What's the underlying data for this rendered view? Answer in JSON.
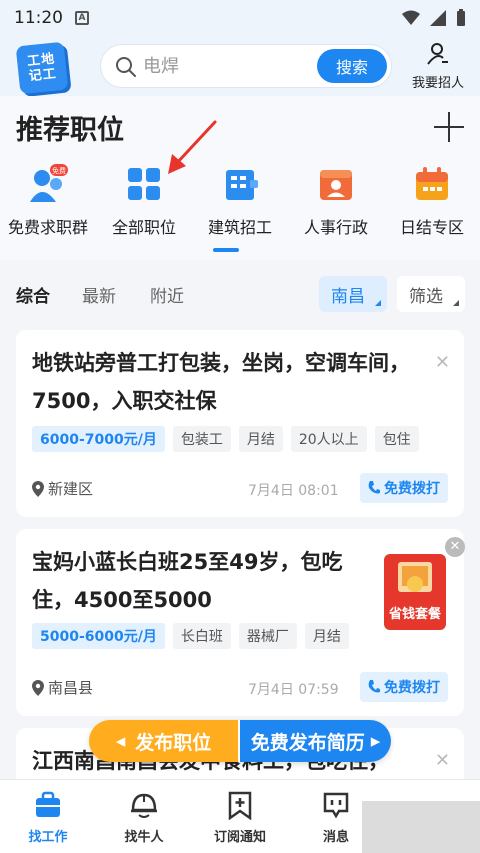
{
  "status": {
    "time": "11:20",
    "a_badge": "A"
  },
  "header": {
    "logo_line1": "工地",
    "logo_line2": "记工",
    "search_placeholder": "电焊",
    "search_button": "搜索",
    "recruit_label": "我要招人"
  },
  "section": {
    "title": "推荐职位"
  },
  "categories": [
    {
      "label": "免费求职群",
      "badge": "免费",
      "icon": "group-chat-icon"
    },
    {
      "label": "全部职位",
      "icon": "grid-icon"
    },
    {
      "label": "建筑招工",
      "icon": "building-icon"
    },
    {
      "label": "人事行政",
      "icon": "id-card-icon"
    },
    {
      "label": "日结专区",
      "icon": "calendar-icon"
    }
  ],
  "filters": {
    "tabs": [
      "综合",
      "最新",
      "附近"
    ],
    "city": "南昌",
    "filter_label": "筛选"
  },
  "jobs": [
    {
      "title": "地铁站旁普工打包装，坐岗，空调车间，7500，入职交社保",
      "salary": "6000-7000元/月",
      "tags": [
        "包装工",
        "月结",
        "20人以上",
        "包住"
      ],
      "location": "新建区",
      "time": "7月4日 08:01",
      "call": "免费拨打"
    },
    {
      "title": "宝妈小蓝长白班25至49岁，包吃住，4500至5000",
      "salary": "5000-6000元/月",
      "tags": [
        "长白班",
        "器械厂",
        "月结"
      ],
      "location": "南昌县",
      "time": "7月4日 07:59",
      "call": "免费拨打"
    },
    {
      "title": "江西南昌南昌会发中食料工，包吃住，"
    }
  ],
  "ad": {
    "label": "省钱套餐"
  },
  "publish": {
    "left": "发布职位",
    "right": "免费发布简历"
  },
  "nav": [
    "找工作",
    "找牛人",
    "订阅通知",
    "消息"
  ],
  "colors": {
    "primary": "#1e86f0",
    "orange": "#ffad1f",
    "ad_red": "#e5372b"
  }
}
